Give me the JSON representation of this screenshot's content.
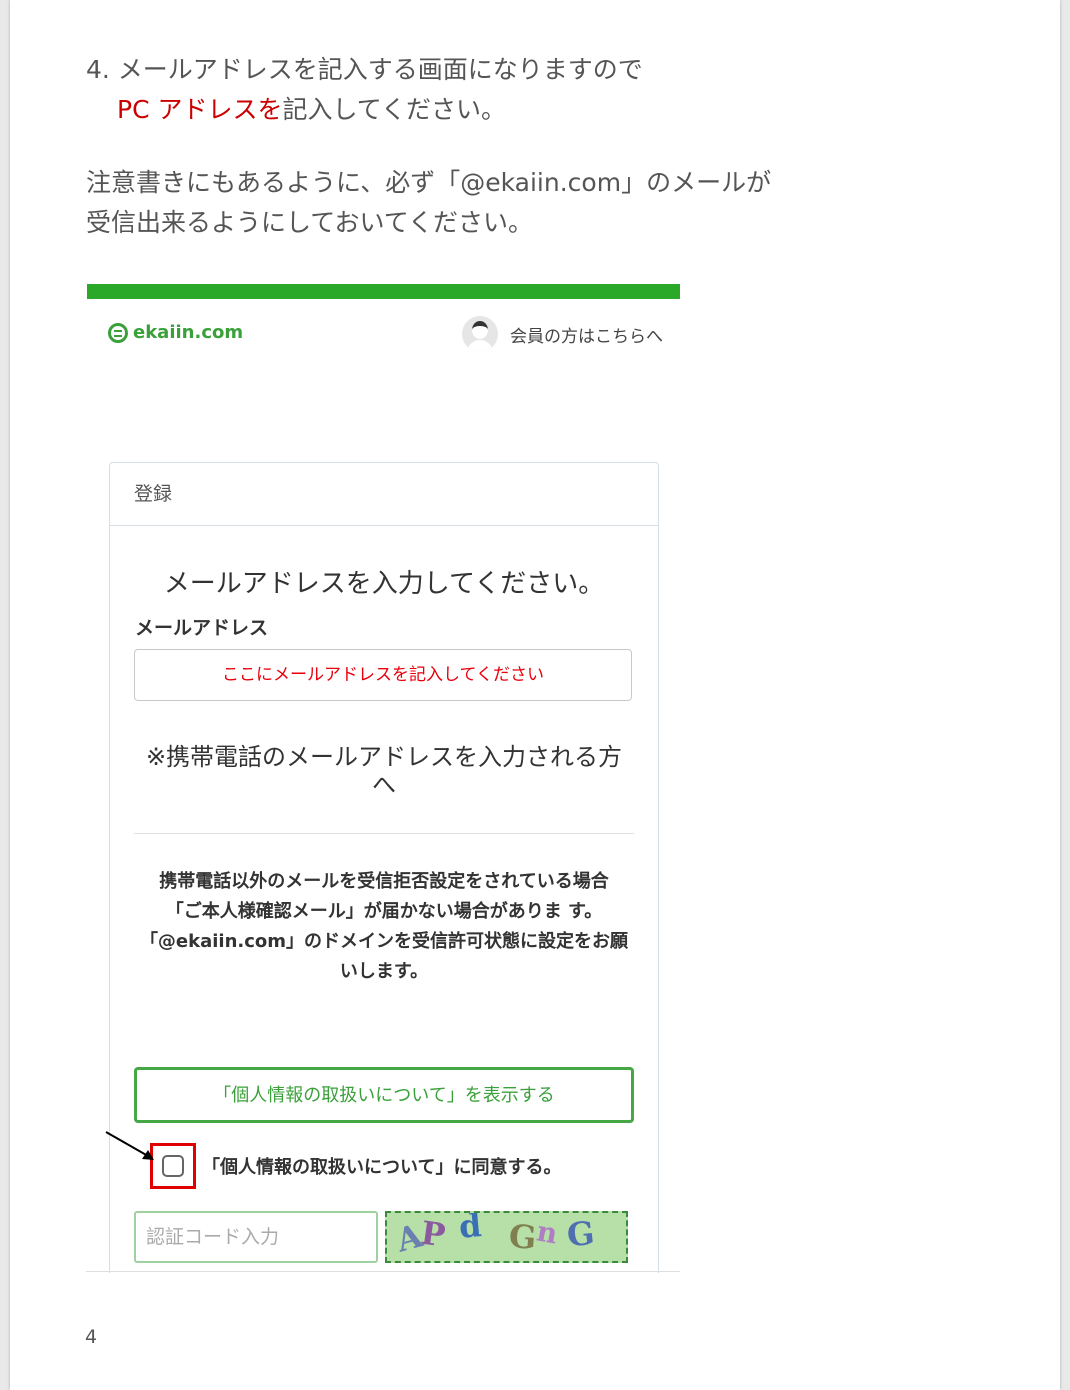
{
  "instruction": {
    "step_line1": "4. メールアドレスを記入する画面になりますので",
    "pc_address": "PC アドレスを",
    "step_line2_rest": "記入してください。",
    "note_line1": "注意書きにもあるように、必ず「@ekaiin.com」のメールが",
    "note_line2": "受信出来るようにしておいてください。"
  },
  "site": {
    "logo_text": "ekaiin.com",
    "member_link": "会員の方はこちらへ"
  },
  "form": {
    "header": "登録",
    "title": "メールアドレスを入力してください。",
    "email_label": "メールアドレス",
    "email_placeholder": "ここにメールアドレスを記入してください",
    "mobile_heading": "※携帯電話のメールアドレスを入力される方へ",
    "notice_lines": [
      "携帯電話以外のメールを受信拒否設定をされている場合",
      "「ご本人様確認メール」が届かない場合がありま す。",
      "「@ekaiin.com」のドメインを受信許可状態に設定をお願いします。"
    ],
    "privacy_button": "「個人情報の取扱いについて」を表示する",
    "consent_label": "「個人情報の取扱いについて」に同意する。",
    "captcha_placeholder": "認証コード入力",
    "captcha_text": "APdGnG"
  },
  "page_number": "4",
  "colors": {
    "accent_green": "#2aa827",
    "highlight_red": "#e00000"
  },
  "icons": [
    "logo-icon",
    "avatar-icon",
    "arrow-icon",
    "checkbox-icon"
  ]
}
